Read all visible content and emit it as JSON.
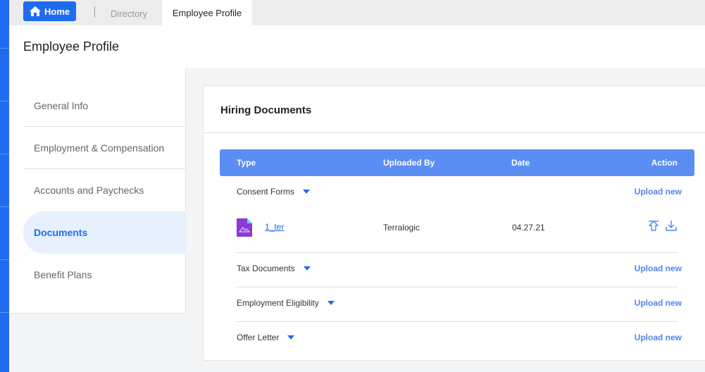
{
  "topbar": {
    "home_label": "Home",
    "breadcrumb_directory": "Directory",
    "breadcrumb_current": "Employee Profile"
  },
  "page": {
    "title": "Employee Profile"
  },
  "sidebar": {
    "items": [
      {
        "label": "General Info",
        "active": false
      },
      {
        "label": "Employment & Compensation",
        "active": false
      },
      {
        "label": "Accounts and Paychecks",
        "active": false
      },
      {
        "label": "Documents",
        "active": true
      },
      {
        "label": "Benefit Plans",
        "active": false
      }
    ]
  },
  "card": {
    "title": "Hiring Documents",
    "columns": [
      "Type",
      "Uploaded By",
      "Date",
      "Action"
    ],
    "groups": [
      {
        "label": "Consent Forms",
        "upload_label": "Upload new",
        "files": [
          {
            "name": "1_ter",
            "uploaded_by": "Terralogic",
            "date": "04.27.21",
            "icon": "image-file-icon"
          }
        ]
      },
      {
        "label": "Tax Documents",
        "upload_label": "Upload new",
        "files": []
      },
      {
        "label": "Employment Eligibility",
        "upload_label": "Upload new",
        "files": []
      },
      {
        "label": "Offer Letter",
        "upload_label": "Upload new",
        "files": []
      }
    ]
  },
  "colors": {
    "accent": "#1f6bf0",
    "header_row": "#5a8ef2",
    "active_nav_bg": "#e7f0fe",
    "file_icon": "#8a3ad6"
  }
}
